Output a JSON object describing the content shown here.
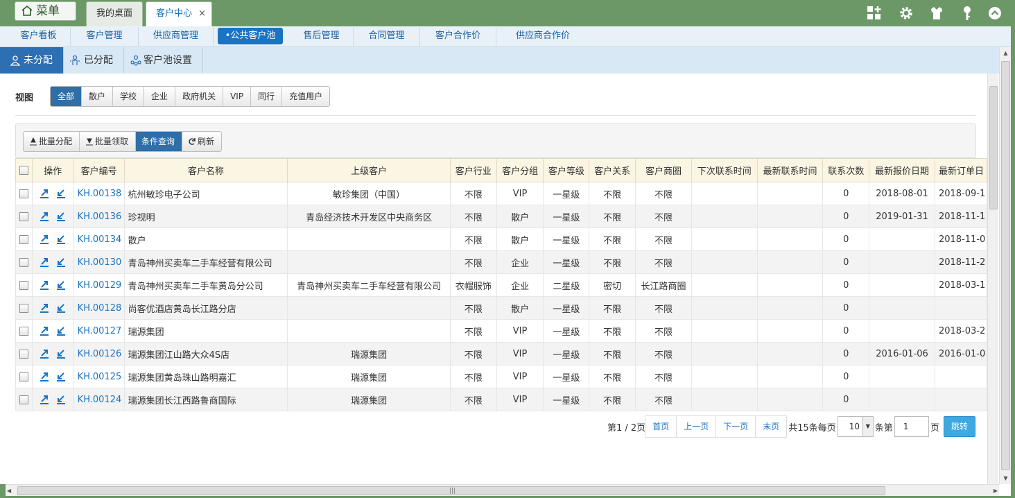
{
  "topbar": {
    "menu_label": "菜单",
    "tabs": [
      {
        "label": "我的桌面"
      },
      {
        "label": "客户中心",
        "close": "×"
      }
    ],
    "icons": [
      "add-widget-icon",
      "settings-icon",
      "shirt-icon",
      "key-icon",
      "collapse-icon"
    ]
  },
  "nav": {
    "items": [
      "客户看板",
      "客户管理",
      "供应商管理",
      "•公共客户池",
      "售后管理",
      "合同管理",
      "客户合作价",
      "供应商合作价"
    ],
    "active": "•公共客户池"
  },
  "subtabs": {
    "items": [
      "未分配",
      "已分配",
      "客户池设置"
    ],
    "active": "未分配"
  },
  "view": {
    "label": "视图",
    "options": [
      "全部",
      "散户",
      "学校",
      "企业",
      "政府机关",
      "VIP",
      "同行",
      "充值用户"
    ],
    "active": "全部"
  },
  "toolbar": {
    "batch_assign": "批量分配",
    "batch_claim": "批量领取",
    "query": "条件查询",
    "refresh": "刷新"
  },
  "table": {
    "columns": [
      "操作",
      "客户编号",
      "客户名称",
      "上级客户",
      "客户行业",
      "客户分组",
      "客户等级",
      "客户关系",
      "客户商圈",
      "下次联系时间",
      "最新联系时间",
      "联系次数",
      "最新报价日期",
      "最新订单日"
    ],
    "rows": [
      {
        "code": "KH.00138",
        "name": "杭州敏珍电子公司",
        "parent": "敏珍集团（中国）",
        "industry": "不限",
        "group": "VIP",
        "level": "一星级",
        "relation": "不限",
        "circle": "不限",
        "next": "",
        "last": "",
        "count": "0",
        "quote": "2018-08-01",
        "order": "2018-09-1"
      },
      {
        "code": "KH.00136",
        "name": "珍视明",
        "parent": "青岛经济技术开发区中央商务区",
        "industry": "不限",
        "group": "散户",
        "level": "一星级",
        "relation": "不限",
        "circle": "不限",
        "next": "",
        "last": "",
        "count": "0",
        "quote": "2019-01-31",
        "order": "2018-11-1"
      },
      {
        "code": "KH.00134",
        "name": "散户",
        "parent": "",
        "industry": "不限",
        "group": "散户",
        "level": "一星级",
        "relation": "不限",
        "circle": "不限",
        "next": "",
        "last": "",
        "count": "0",
        "quote": "",
        "order": "2018-11-0"
      },
      {
        "code": "KH.00130",
        "name": "青岛神州买卖车二手车经营有限公司",
        "parent": "",
        "industry": "不限",
        "group": "企业",
        "level": "一星级",
        "relation": "不限",
        "circle": "不限",
        "next": "",
        "last": "",
        "count": "0",
        "quote": "",
        "order": "2018-11-2"
      },
      {
        "code": "KH.00129",
        "name": "青岛神州买卖车二手车黄岛分公司",
        "parent": "青岛神州买卖车二手车经营有限公司",
        "industry": "衣帽服饰",
        "group": "企业",
        "level": "二星级",
        "relation": "密切",
        "circle": "长江路商圈",
        "next": "",
        "last": "",
        "count": "0",
        "quote": "",
        "order": "2018-03-1"
      },
      {
        "code": "KH.00128",
        "name": "尚客优酒店黄岛长江路分店",
        "parent": "",
        "industry": "不限",
        "group": "散户",
        "level": "一星级",
        "relation": "不限",
        "circle": "不限",
        "next": "",
        "last": "",
        "count": "0",
        "quote": "",
        "order": ""
      },
      {
        "code": "KH.00127",
        "name": "瑞源集团",
        "parent": "",
        "industry": "不限",
        "group": "VIP",
        "level": "一星级",
        "relation": "不限",
        "circle": "不限",
        "next": "",
        "last": "",
        "count": "0",
        "quote": "",
        "order": "2018-03-2"
      },
      {
        "code": "KH.00126",
        "name": "瑞源集团江山路大众4S店",
        "parent": "瑞源集团",
        "industry": "不限",
        "group": "VIP",
        "level": "一星级",
        "relation": "不限",
        "circle": "不限",
        "next": "",
        "last": "",
        "count": "0",
        "quote": "2016-01-06",
        "order": "2016-01-0"
      },
      {
        "code": "KH.00125",
        "name": "瑞源集团黄岛珠山路明嘉汇",
        "parent": "瑞源集团",
        "industry": "不限",
        "group": "VIP",
        "level": "一星级",
        "relation": "不限",
        "circle": "不限",
        "next": "",
        "last": "",
        "count": "0",
        "quote": "",
        "order": ""
      },
      {
        "code": "KH.00124",
        "name": "瑞源集团长江西路鲁商国际",
        "parent": "瑞源集团",
        "industry": "不限",
        "group": "VIP",
        "level": "一星级",
        "relation": "不限",
        "circle": "不限",
        "next": "",
        "last": "",
        "count": "0",
        "quote": "",
        "order": ""
      }
    ]
  },
  "pager": {
    "info": "第1 / 2页",
    "first": "首页",
    "prev": "上一页",
    "next": "下一页",
    "last": "末页",
    "total": "共15条每页",
    "page_size": "10",
    "per": "条第",
    "page": "1",
    "page_suffix": "页",
    "go": "跳转"
  }
}
